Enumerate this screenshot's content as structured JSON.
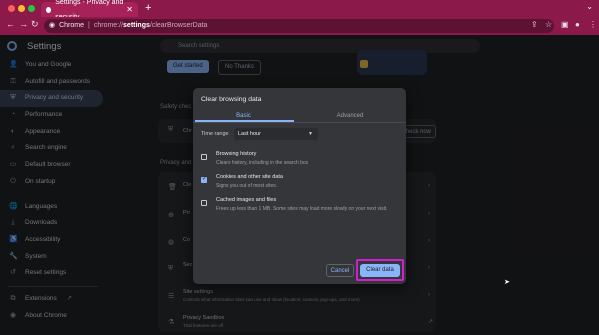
{
  "browser": {
    "tab_title": "Settings - Privacy and security",
    "omnibox_label": "Chrome",
    "url_host": "chrome://",
    "url_bold": "settings",
    "url_path": "/clearBrowserData",
    "frame_color": "#8b1a4a"
  },
  "settings": {
    "title": "Settings",
    "search_placeholder": "Search settings"
  },
  "sidebar": {
    "items": [
      {
        "label": "You and Google",
        "icon": "person-icon"
      },
      {
        "label": "Autofill and passwords",
        "icon": "key-icon"
      },
      {
        "label": "Privacy and security",
        "icon": "shield-icon"
      },
      {
        "label": "Performance",
        "icon": "speedometer-icon"
      },
      {
        "label": "Appearance",
        "icon": "palette-icon"
      },
      {
        "label": "Search engine",
        "icon": "search-icon"
      },
      {
        "label": "Default browser",
        "icon": "browser-icon"
      },
      {
        "label": "On startup",
        "icon": "power-icon"
      },
      {
        "label": "Languages",
        "icon": "globe-icon"
      },
      {
        "label": "Downloads",
        "icon": "download-icon"
      },
      {
        "label": "Accessibility",
        "icon": "accessibility-icon"
      },
      {
        "label": "System",
        "icon": "wrench-icon"
      },
      {
        "label": "Reset settings",
        "icon": "reset-icon"
      },
      {
        "label": "Extensions",
        "icon": "puzzle-icon"
      },
      {
        "label": "About Chrome",
        "icon": "chrome-icon"
      }
    ]
  },
  "background": {
    "get_started": "Get started",
    "no_thanks": "No Thanks",
    "safety_check": "Safety chec",
    "check_now": "Check now",
    "privacy_and": "Privacy and",
    "rows": [
      "Cle",
      "Pri",
      "Co",
      "Sec"
    ],
    "site_settings_title": "Site settings",
    "site_settings_sub": "Controls what information sites can use and show (location, camera, pop-ups, and more)",
    "privacy_sandbox_title": "Privacy Sandbox",
    "privacy_sandbox_sub": "Trial features are off"
  },
  "dialog": {
    "title": "Clear browsing data",
    "tabs": [
      "Basic",
      "Advanced"
    ],
    "time_range_label": "Time range",
    "time_range_value": "Last hour",
    "options": [
      {
        "title": "Browsing history",
        "desc": "Clears history, including in the search box",
        "checked": false
      },
      {
        "title": "Cookies and other site data",
        "desc": "Signs you out of most sites.",
        "checked": true
      },
      {
        "title": "Cached images and files",
        "desc": "Frees up less than 1 MB. Some sites may load more slowly on your next visit.",
        "checked": false
      }
    ],
    "cancel": "Cancel",
    "clear_data": "Clear data",
    "highlight_color": "#d01fd0"
  }
}
